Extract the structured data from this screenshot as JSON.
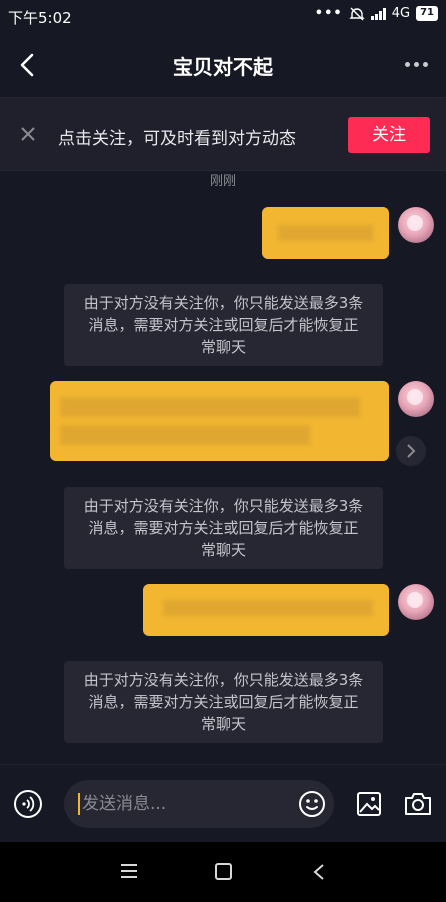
{
  "status_bar": {
    "time": "下午5:02",
    "network": "4G",
    "battery": "71"
  },
  "header": {
    "title": "宝贝对不起"
  },
  "follow_banner": {
    "text": "点击关注，可及时看到对方动态",
    "button_label": "关注"
  },
  "timestamp": "刚刚",
  "system_notices": [
    "由于对方没有关注你，你只能发送最多3条消息，需要对方关注或回复后才能恢复正常聊天",
    "由于对方没有关注你，你只能发送最多3条消息，需要对方关注或回复后才能恢复正常聊天",
    "由于对方没有关注你，你只能发送最多3条消息，需要对方关注或回复后才能恢复正常聊天"
  ],
  "input": {
    "placeholder": "发送消息..."
  },
  "colors": {
    "background": "#161823",
    "bubble": "#f2b631",
    "accent": "#fe2c55",
    "notice_bg": "#262733"
  },
  "icons": [
    "back-arrow-icon",
    "more-icon",
    "close-icon",
    "voice-icon",
    "emoji-icon",
    "image-icon",
    "camera-icon",
    "forward-icon",
    "menu-icon",
    "home-icon",
    "nav-back-icon"
  ]
}
